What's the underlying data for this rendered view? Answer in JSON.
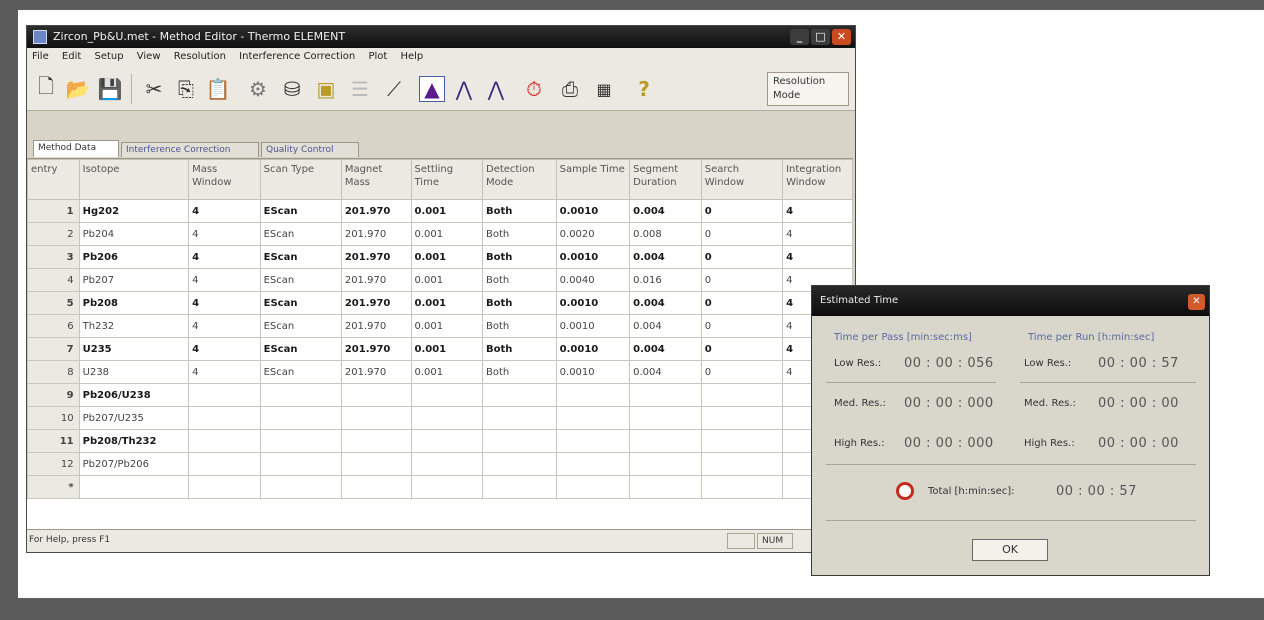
{
  "main_window": {
    "title": "Zircon_Pb&U.met - Method Editor - Thermo ELEMENT",
    "menu": [
      "File",
      "Edit",
      "Setup",
      "View",
      "Resolution",
      "Interference Correction",
      "Plot",
      "Help"
    ],
    "toolbar_icons": [
      "new-icon",
      "open-icon",
      "save-icon",
      "cut-icon",
      "copy-icon",
      "paste-icon",
      "gear-icon",
      "tune-icon",
      "device-icon",
      "list-icon",
      "wand-icon",
      "low-res-icon",
      "med-res-icon",
      "high-res-icon",
      "timer-icon",
      "print-icon",
      "calculator-icon",
      "help-icon"
    ],
    "resolution_mode": "Resolution\nMode",
    "tabs": [
      "Method Data",
      "Interference Correction",
      "Quality Control"
    ],
    "columns": [
      "entry",
      "Isotope",
      "Mass Window",
      "Scan Type",
      "Magnet Mass",
      "Settling Time",
      "Detection Mode",
      "Sample Time",
      "Segment Duration",
      "Search Window",
      "Integration Window"
    ],
    "rows": [
      [
        "1",
        "Hg202",
        "4",
        "EScan",
        "201.970",
        "0.001",
        "Both",
        "0.0010",
        "0.004",
        "0",
        "4"
      ],
      [
        "2",
        "Pb204",
        "4",
        "EScan",
        "201.970",
        "0.001",
        "Both",
        "0.0020",
        "0.008",
        "0",
        "4"
      ],
      [
        "3",
        "Pb206",
        "4",
        "EScan",
        "201.970",
        "0.001",
        "Both",
        "0.0010",
        "0.004",
        "0",
        "4"
      ],
      [
        "4",
        "Pb207",
        "4",
        "EScan",
        "201.970",
        "0.001",
        "Both",
        "0.0040",
        "0.016",
        "0",
        "4"
      ],
      [
        "5",
        "Pb208",
        "4",
        "EScan",
        "201.970",
        "0.001",
        "Both",
        "0.0010",
        "0.004",
        "0",
        "4"
      ],
      [
        "6",
        "Th232",
        "4",
        "EScan",
        "201.970",
        "0.001",
        "Both",
        "0.0010",
        "0.004",
        "0",
        "4"
      ],
      [
        "7",
        "U235",
        "4",
        "EScan",
        "201.970",
        "0.001",
        "Both",
        "0.0010",
        "0.004",
        "0",
        "4"
      ],
      [
        "8",
        "U238",
        "4",
        "EScan",
        "201.970",
        "0.001",
        "Both",
        "0.0010",
        "0.004",
        "0",
        "4"
      ],
      [
        "9",
        "Pb206/U238",
        "",
        "",
        "",
        "",
        "",
        "",
        "",
        "",
        ""
      ],
      [
        "10",
        "Pb207/U235",
        "",
        "",
        "",
        "",
        "",
        "",
        "",
        "",
        ""
      ],
      [
        "11",
        "Pb208/Th232",
        "",
        "",
        "",
        "",
        "",
        "",
        "",
        "",
        ""
      ],
      [
        "12",
        "Pb207/Pb206",
        "",
        "",
        "",
        "",
        "",
        "",
        "",
        "",
        ""
      ],
      [
        "*",
        "",
        "",
        "",
        "",
        "",
        "",
        "",
        "",
        "",
        ""
      ]
    ],
    "status_text": "For Help, press F1",
    "status_num": "NUM"
  },
  "dialog": {
    "title": "Estimated Time",
    "col1_header": "Time per Pass [min:sec:ms]",
    "col2_header": "Time per Run [h:min:sec]",
    "low_label": "Low Res.:",
    "med_label": "Med. Res.:",
    "high_label": "High Res.:",
    "low_pass": "00 : 00 : 056",
    "med_pass": "00 : 00 : 000",
    "high_pass": "00 : 00 : 000",
    "low_run": "00 : 00 : 57",
    "med_run": "00 : 00 : 00",
    "high_run": "00 : 00 : 00",
    "total_label": "Total [h:min:sec]:",
    "total_value": "00 : 00 : 57",
    "ok_label": "OK"
  }
}
